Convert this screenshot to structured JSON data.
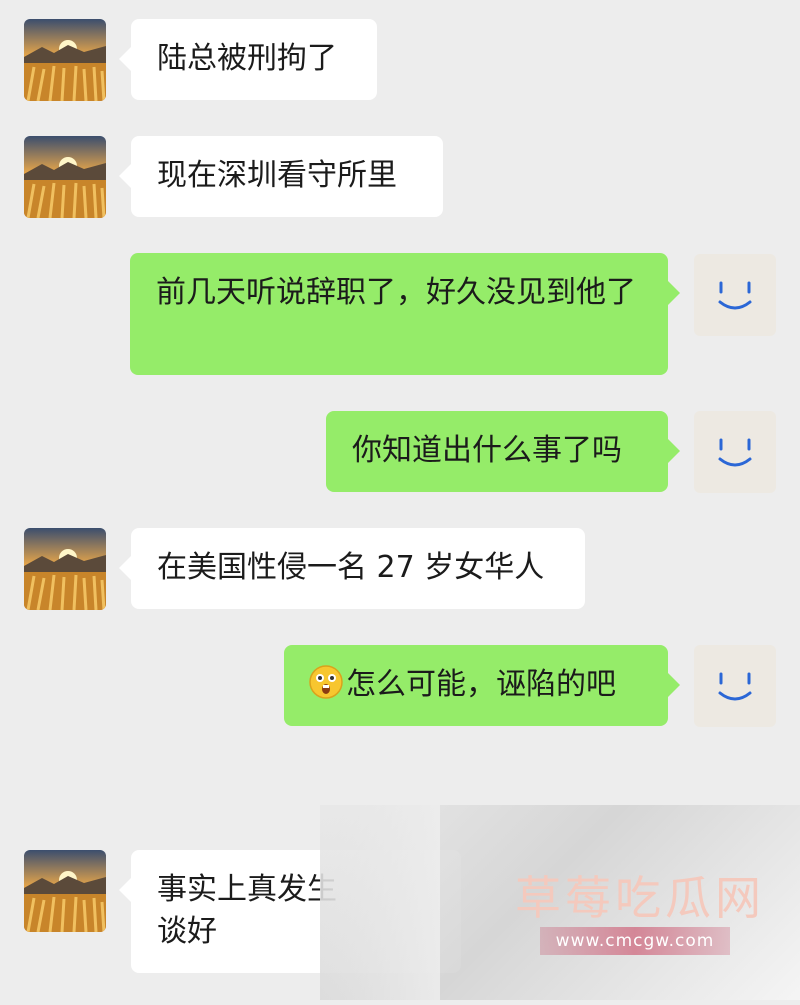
{
  "theme": {
    "background": "#ededed",
    "outgoing_bubble": "#95ec69",
    "incoming_bubble": "#ffffff"
  },
  "messages": [
    {
      "side": "in",
      "text": "陆总被刑拘了",
      "avatar": "wheat-field-sunset-avatar"
    },
    {
      "side": "in",
      "text": "现在深圳看守所里",
      "avatar": "wheat-field-sunset-avatar"
    },
    {
      "side": "out",
      "text": "前几天听说辞职了，好久没见到他了",
      "avatar": "smiley-face-avatar"
    },
    {
      "side": "out",
      "text": "你知道出什么事了吗",
      "avatar": "smiley-face-avatar"
    },
    {
      "side": "in",
      "text": "在美国性侵一名 27 岁女华人",
      "avatar": "wheat-field-sunset-avatar"
    },
    {
      "side": "out",
      "text": "怎么可能，诬陷的吧",
      "emoji": "shocked-face-emoji",
      "avatar": "smiley-face-avatar"
    },
    {
      "side": "in",
      "text": "事实上真发生",
      "text_line2": "谈好",
      "avatar": "wheat-field-sunset-avatar"
    }
  ],
  "watermark": {
    "title": "草莓吃瓜网",
    "url": "www.cmcgw.com"
  }
}
